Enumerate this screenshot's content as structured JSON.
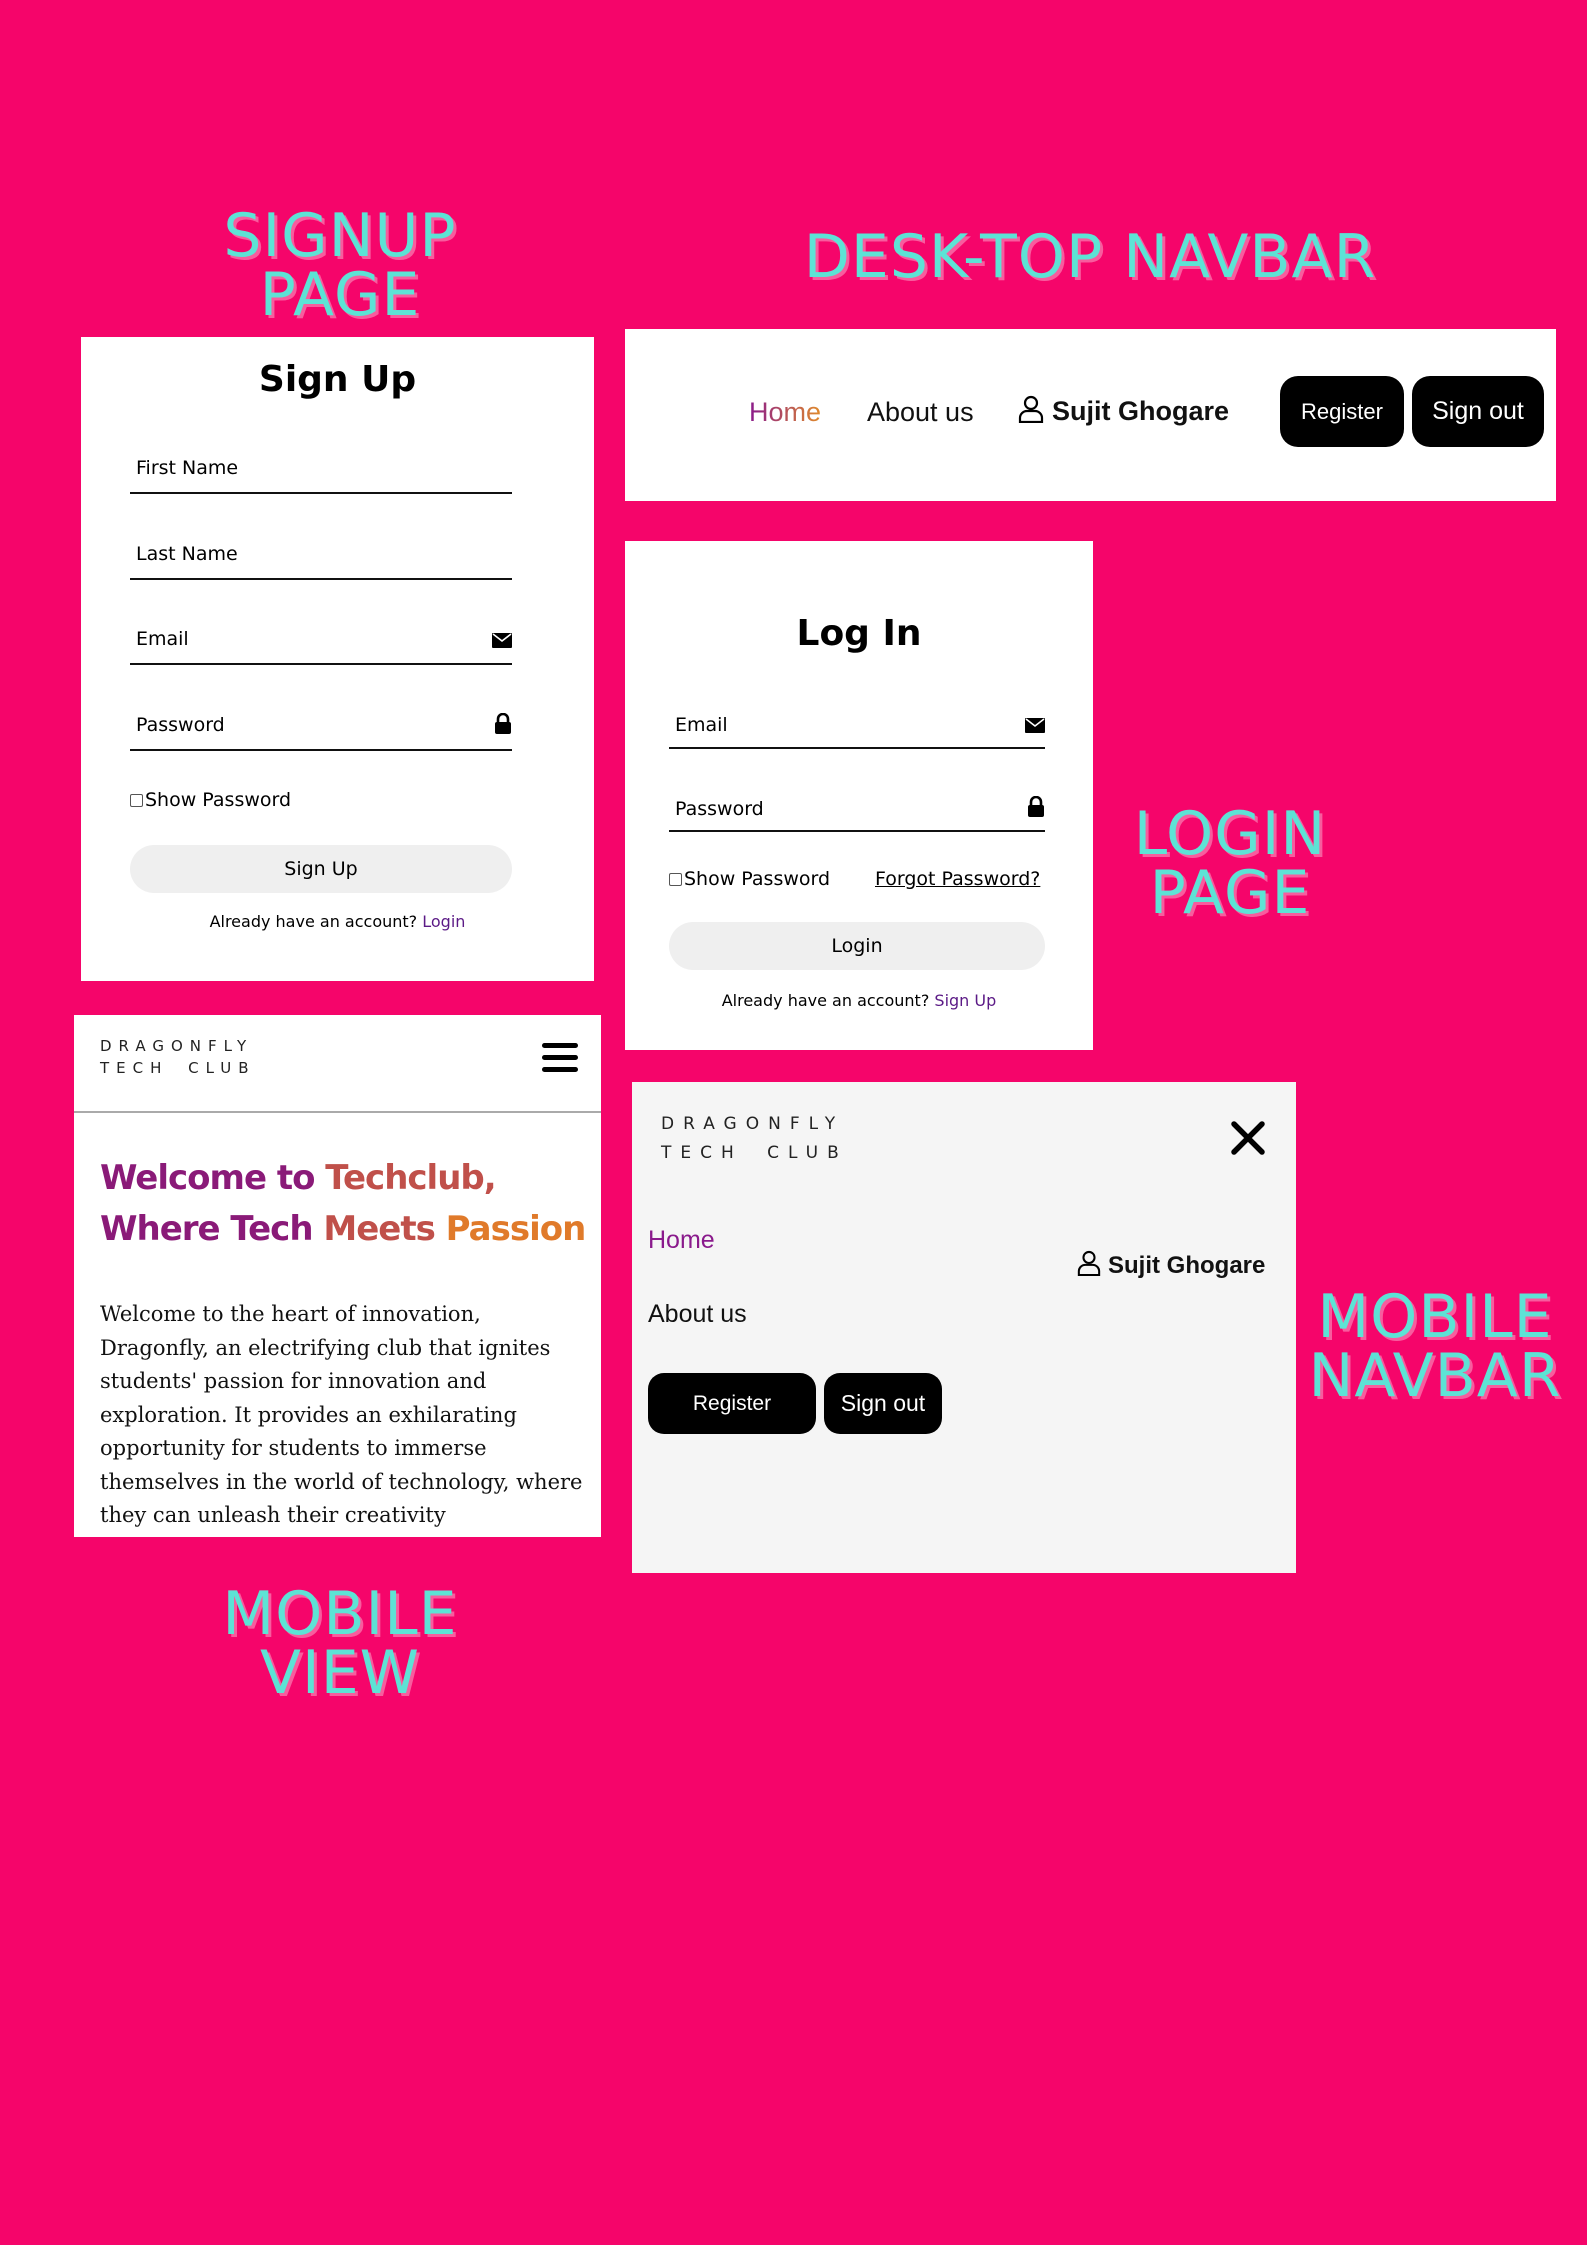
{
  "labels": {
    "signup": [
      "SIGNUP",
      "PAGE"
    ],
    "desktop_navbar": "DESK-TOP NAVBAR",
    "login": [
      "LOGIN",
      "PAGE"
    ],
    "mobile_navbar": [
      "MOBILE",
      "NAVBAR"
    ],
    "mobile_view": [
      "MOBILE",
      "VIEW"
    ]
  },
  "signup": {
    "title": "Sign Up",
    "first_name": "First Name",
    "last_name": "Last Name",
    "email": "Email",
    "password": "Password",
    "show_password": "Show Password",
    "submit": "Sign Up",
    "already": "Already have an account?",
    "login_link": "Login"
  },
  "desktop_nav": {
    "home": "Home",
    "about": "About us",
    "user": "Sujit Ghogare",
    "register": "Register",
    "signout": "Sign out"
  },
  "login": {
    "title": "Log In",
    "email": "Email",
    "password": "Password",
    "show_password": "Show Password",
    "forgot": "Forgot Password?",
    "submit": "Login",
    "already": "Already have an account?",
    "signup_link": "Sign Up"
  },
  "mobile_view": {
    "logo_line1": "DRAGONFLY",
    "logo_line2": "TECH CLUB",
    "heading_part1": "Welcome to ",
    "heading_part2": "Techclub,",
    "heading_part3": "Where Tech ",
    "heading_part4": "Meets ",
    "heading_part5": "Passion",
    "body": "Welcome to the heart of innovation, Dragonfly, an electrifying club that ignites students' passion for innovation and exploration. It provides an exhilarating opportunity for students to immerse themselves in the world of technology, where they can unleash their creativity"
  },
  "mobile_nav": {
    "logo_line1": "DRAGONFLY",
    "logo_line2": "TECH CLUB",
    "home": "Home",
    "about": "About us",
    "user": "Sujit Ghogare",
    "register": "Register",
    "signout": "Sign out"
  },
  "colors": {
    "background": "#f5056a",
    "label": "#5de3d5",
    "home_purple": "#8a1a8c",
    "gradient_orange": "#e08a2a",
    "link_purple": "#5b1a86"
  }
}
